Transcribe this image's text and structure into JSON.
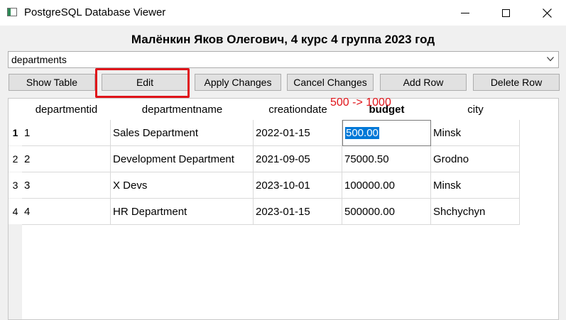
{
  "window": {
    "title": "PostgreSQL Database Viewer",
    "icon": "app-window-icon"
  },
  "header": {
    "text": "Малёнкин Яков Олегович, 4 курс 4 группа 2023 год"
  },
  "table_selector": {
    "selected": "departments"
  },
  "toolbar": {
    "show_table": "Show Table",
    "edit": "Edit",
    "apply_changes": "Apply Changes",
    "cancel_changes": "Cancel Changes",
    "add_row": "Add Row",
    "delete_row": "Delete Row"
  },
  "annotation": {
    "text": "500 -> 1000",
    "color": "#e0141a",
    "highlight_color": "#e0141a"
  },
  "table": {
    "columns": [
      "departmentid",
      "departmentname",
      "creationdate",
      "budget",
      "city"
    ],
    "current_column": "budget",
    "row_numbers": [
      "1",
      "2",
      "3",
      "4"
    ],
    "current_row": "1",
    "rows": [
      [
        "1",
        "Sales Department",
        "2022-01-15",
        "500.00",
        "Minsk"
      ],
      [
        "2",
        "Development Department",
        "2021-09-05",
        "75000.50",
        "Grodno"
      ],
      [
        "3",
        "X Devs",
        "2023-10-01",
        "100000.00",
        "Minsk"
      ],
      [
        "4",
        "HR Department",
        "2023-01-15",
        "500000.00",
        "Shchychyn"
      ]
    ]
  },
  "colors": {
    "selection": "#0078d7",
    "button_face": "#e1e1e1"
  }
}
